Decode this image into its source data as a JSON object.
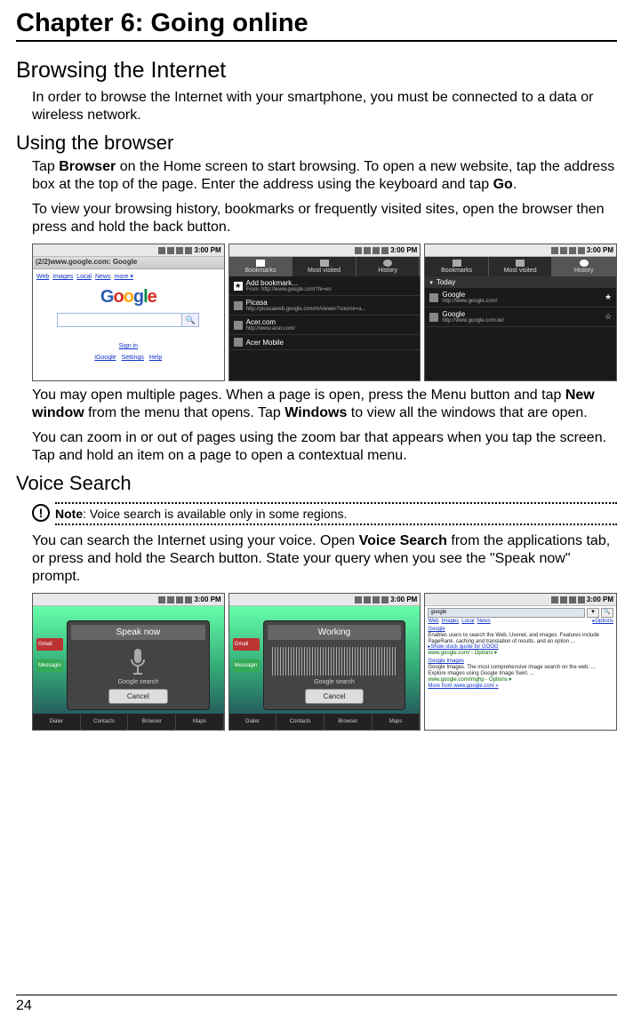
{
  "chapter_title": "Chapter 6: Going online",
  "h1_1": "Browsing the Internet",
  "p1": "In order to browse the Internet with your smartphone, you must be connected to a data or wireless network.",
  "h2_1": "Using the browser",
  "p2a": "Tap ",
  "p2b": "Browser",
  "p2c": " on the Home screen to start browsing. To open a new website, tap the address box at the top of the page. Enter the address using the keyboard and tap ",
  "p2d": "Go",
  "p2e": ".",
  "p3": "To view your browsing history, bookmarks or frequently visited sites, open the browser then press and hold the back button.",
  "screens1": {
    "time": "3:00 PM",
    "s1": {
      "url": "(2/2)www.google.com: Google",
      "toplinks": [
        "Web",
        "Images",
        "Local",
        "News",
        "more ▾"
      ],
      "signin": "Sign in",
      "bottomlinks": [
        "iGoogle",
        "Settings",
        "Help"
      ]
    },
    "s2": {
      "tabs": [
        "Bookmarks",
        "Most visited",
        "History"
      ],
      "rows": [
        {
          "title": "Add bookmark...",
          "sub": "From: http://www.google.com?hl=en"
        },
        {
          "title": "Picasa",
          "sub": "http://picasaweb.google.com/m/viewer?source=a..."
        },
        {
          "title": "Acer.com",
          "sub": "http://www.acer.com/"
        },
        {
          "title": "Acer Mobile",
          "sub": ""
        }
      ]
    },
    "s3": {
      "tabs": [
        "Bookmarks",
        "Most visited",
        "History"
      ],
      "header": "Today",
      "rows": [
        {
          "title": "Google",
          "sub": "http://www.google.com/"
        },
        {
          "title": "Google",
          "sub": "http://www.google.com.tw/"
        }
      ]
    }
  },
  "p4a": "You may open multiple pages. When a page is open, press the Menu button and tap ",
  "p4b": "New window",
  "p4c": " from the menu that opens. Tap ",
  "p4d": "Windows",
  "p4e": " to view all the windows that are open.",
  "p5": "You can zoom in or out of pages using the zoom bar that appears when you tap the screen. Tap and hold an item on a page to open a contextual menu.",
  "h2_2": "Voice Search",
  "note_bold": "Note",
  "note_text": ": Voice search is available only in some regions.",
  "p6a": "You can search the Internet using your voice. Open ",
  "p6b": "Voice Search",
  "p6c": " from the applications tab, or press and hold the Search button. State your query when you see the \"Speak now\" prompt.",
  "screens2": {
    "time": "3:00 PM",
    "homeapps": [
      "Dialer",
      "Contacts",
      "Browser",
      "Maps"
    ],
    "homeicons": [
      "Gmail",
      "Messagin"
    ],
    "s1": {
      "title": "Speak now",
      "sub": "Google search",
      "btn": "Cancel"
    },
    "s2": {
      "title": "Working",
      "sub": "Google search",
      "btn": "Cancel"
    },
    "s3": {
      "query": "google",
      "links": [
        "Web",
        "Images",
        "Local",
        "News"
      ],
      "options": "▸Options",
      "r1_title": "Google",
      "r1_desc": "Enables users to search the Web, Usenet, and images. Features include PageRank, caching and translation of results, and an option ...",
      "r1_stock": "▸Show stock quote for GOOG",
      "r1_url": "www.google.com/ - Options ▾",
      "r2_title": "Google Images",
      "r2_desc": "Google Images. The most comprehensive image search on the web. ... Explore images using Google Image Swirl. ...",
      "r2_url": "www.google.com/imghp - Options ▾",
      "r2_more": "More from www.google.com »"
    }
  },
  "page_number": "24"
}
